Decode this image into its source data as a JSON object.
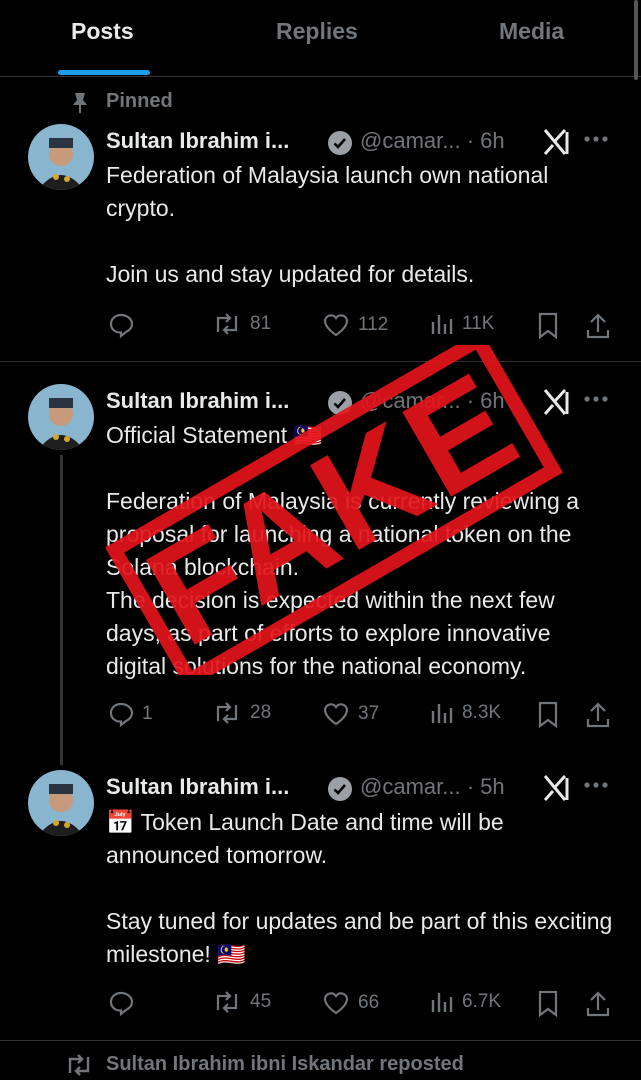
{
  "tabs": [
    {
      "label": "Posts"
    },
    {
      "label": "Replies"
    },
    {
      "label": "Media"
    }
  ],
  "pinned_label": "Pinned",
  "posts": [
    {
      "name": "Sultan Ibrahim i...",
      "handle": "@camar...",
      "time": "· 6h",
      "text": "Federation of Malaysia launch own national crypto.\n\nJoin us and stay updated for details.",
      "replies": "",
      "reposts": "81",
      "likes": "112",
      "views": "11K"
    },
    {
      "name": "Sultan Ibrahim i...",
      "handle": "@camar...",
      "time": "· 6h",
      "text": "Official Statement 🇲🇾\n\nFederation of Malaysia is currently reviewing a proposal for launching a national token on the Solana blockchain.\nThe decision is expected within the next few days, as part of efforts to explore innovative digital solutions for the national economy.",
      "replies": "1",
      "reposts": "28",
      "likes": "37",
      "views": "8.3K"
    },
    {
      "name": "Sultan Ibrahim i...",
      "handle": "@camar...",
      "time": "· 5h",
      "text": "📅 Token Launch Date and time will be announced tomorrow.\n\nStay tuned for updates and be part of this exciting milestone! 🇲🇾",
      "replies": "",
      "reposts": "45",
      "likes": "66",
      "views": "6.7K"
    }
  ],
  "stamp_text": "FAKE",
  "repost_notice": "Sultan Ibrahim ibni Iskandar reposted",
  "colors": {
    "accent": "#1d9bf0",
    "stamp": "#e3141b",
    "muted": "#71767b"
  }
}
